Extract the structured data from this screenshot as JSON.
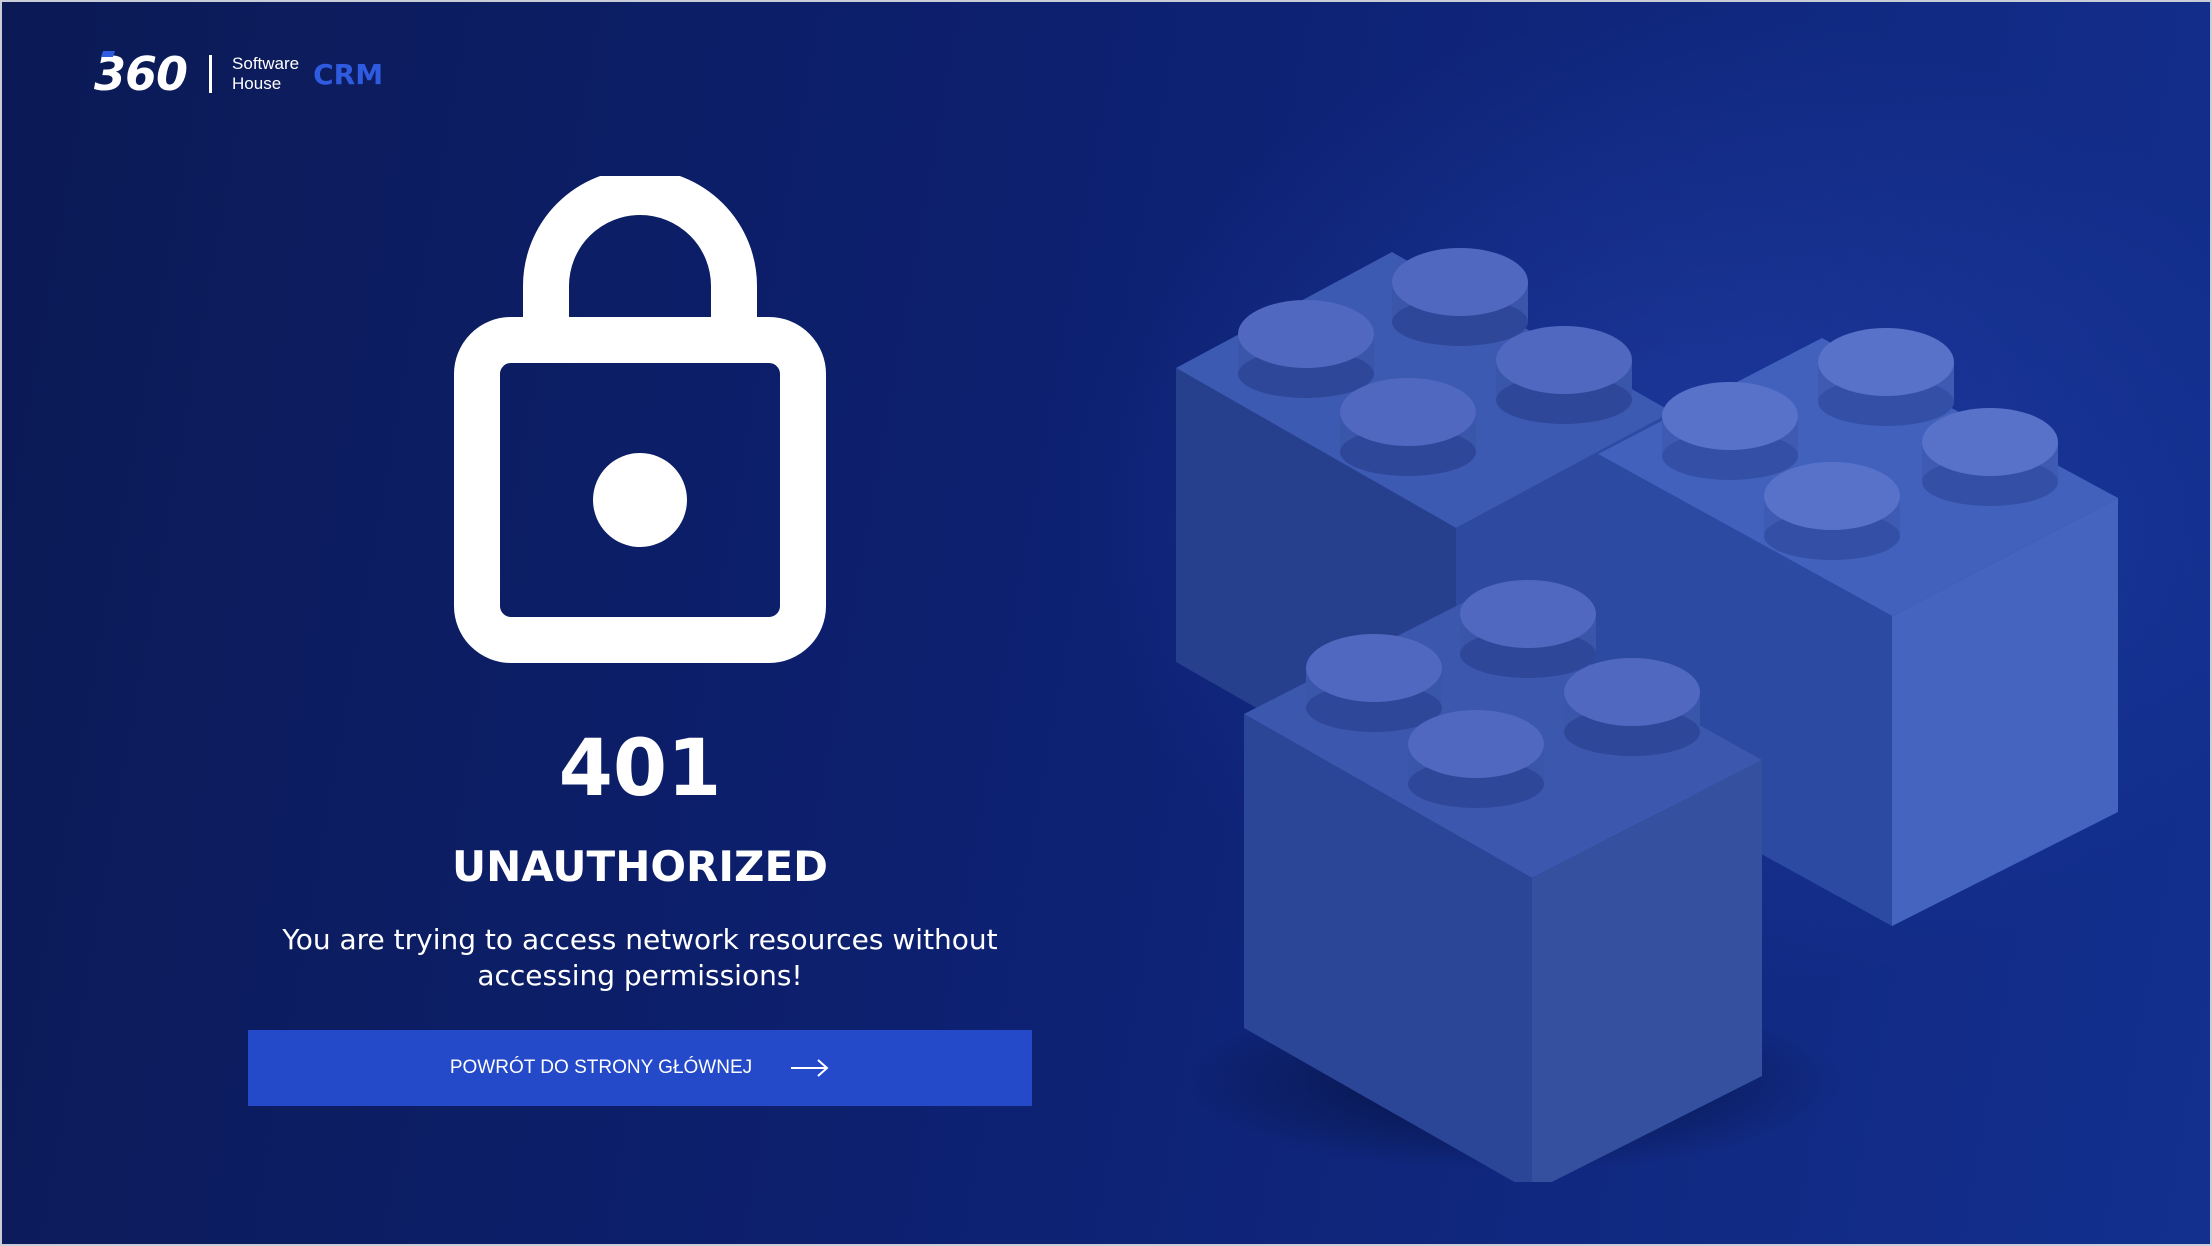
{
  "brand": {
    "logo_text": "360",
    "sub_line1": "Software",
    "sub_line2": "House",
    "product": "CRM"
  },
  "error": {
    "code": "401",
    "title": "UNAUTHORIZED",
    "message": "You are trying to access network resources without accessing permissions!"
  },
  "actions": {
    "home_button_label": "POWRÓT DO STRONY GŁÓWNEJ"
  },
  "icons": {
    "lock": "lock-icon",
    "arrow": "arrow-right-icon",
    "illustration": "building-bricks-illustration"
  },
  "colors": {
    "background": "#0d2070",
    "accent": "#2449c9",
    "crm_text": "#2f5be0",
    "brick": "#3d59b3",
    "text": "#ffffff"
  }
}
